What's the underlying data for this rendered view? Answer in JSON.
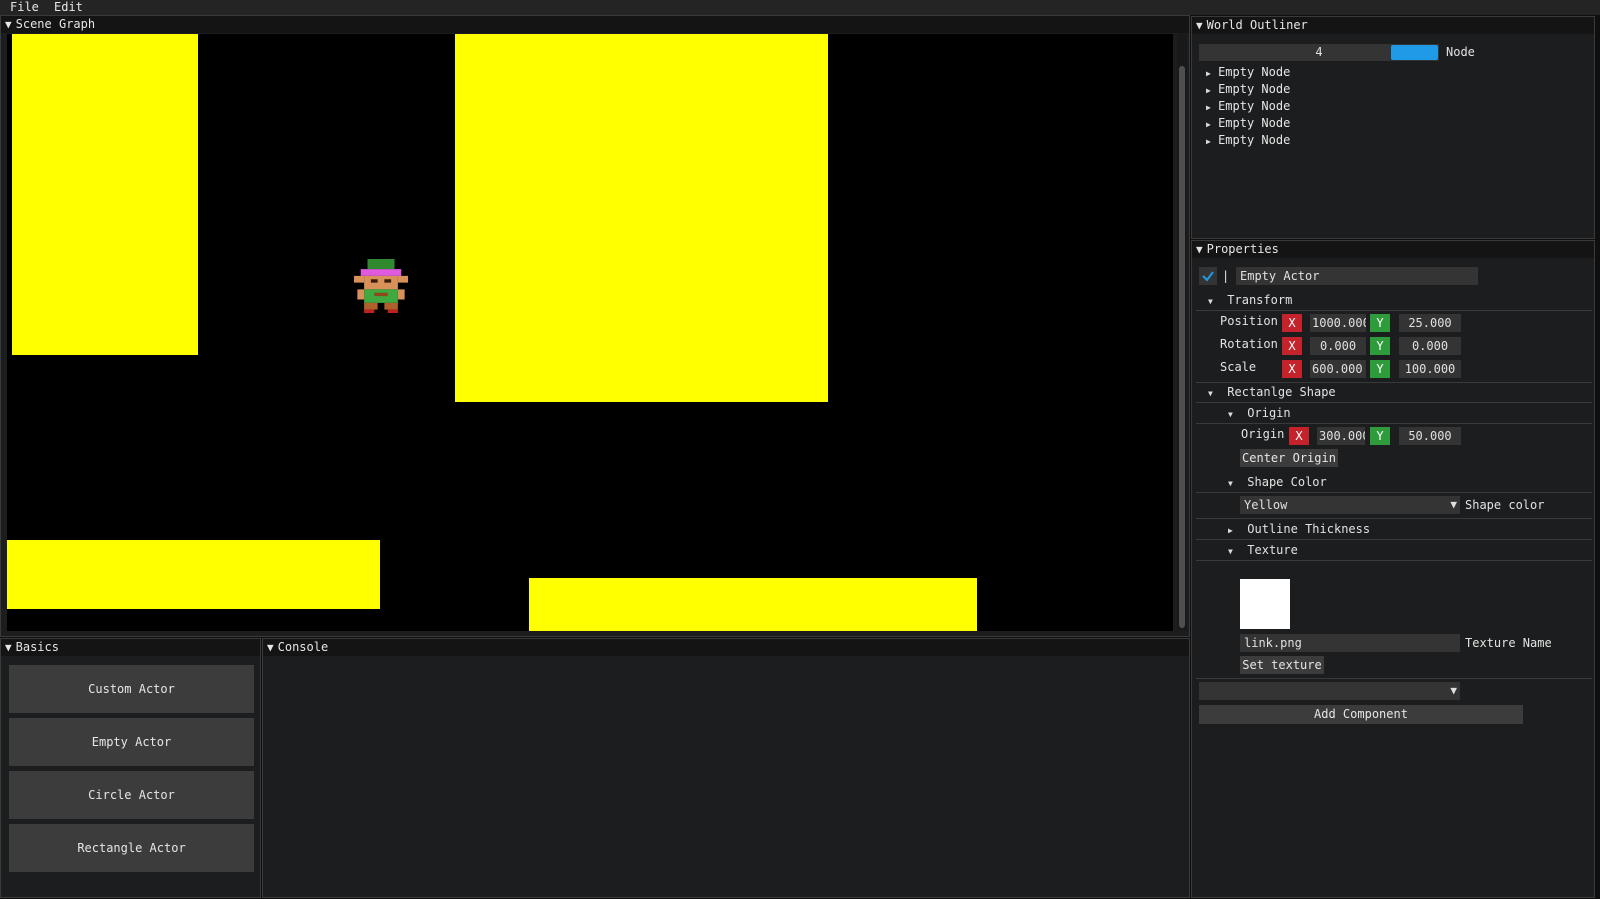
{
  "menubar": {
    "items": [
      "File",
      "Edit"
    ]
  },
  "scene_graph": {
    "title": "Scene Graph"
  },
  "world_outliner": {
    "title": "World Outliner",
    "count_value": "4",
    "node_label": "Node",
    "nodes": [
      "Empty Node",
      "Empty Node",
      "Empty Node",
      "Empty Node",
      "Empty Node"
    ]
  },
  "properties": {
    "title": "Properties",
    "actor_name": "Empty Actor",
    "separator_glyph": "|",
    "transform": {
      "header": "Transform",
      "position": {
        "label": "Position",
        "x": "1000.000",
        "y": "25.000"
      },
      "rotation": {
        "label": "Rotation",
        "x": "0.000",
        "y": "0.000"
      },
      "scale": {
        "label": "Scale",
        "x": "600.000",
        "y": "100.000"
      }
    },
    "rect_shape": {
      "header": "Rectanlge Shape",
      "origin_header": "Origin",
      "origin": {
        "label": "Origin",
        "x": "300.000",
        "y": "50.000"
      },
      "center_origin_button": "Center Origin",
      "shape_color_header": "Shape Color",
      "shape_color_value": "Yellow",
      "shape_color_label": "Shape color",
      "outline_thickness_header": "Outline Thickness",
      "texture_header": "Texture",
      "texture_name_value": "link.png",
      "texture_name_label": "Texture Name",
      "set_texture_button": "Set texture"
    },
    "component_dropdown_value": "",
    "add_component_button": "Add Component",
    "axis_x": "X",
    "axis_y": "Y"
  },
  "basics": {
    "title": "Basics",
    "buttons": [
      "Custom Actor",
      "Empty Actor",
      "Circle Actor",
      "Rectangle Actor"
    ]
  },
  "console": {
    "title": "Console"
  },
  "colors": {
    "accent": "#1f9ae6",
    "axis_x": "#c4232b",
    "axis_y": "#2e9c3a",
    "shape_yellow": "#ffff00"
  },
  "icons": [
    "collapse-triangle-icon",
    "expand-triangle-icon",
    "checkmark-icon",
    "dropdown-arrow-icon",
    "link-sprite"
  ]
}
